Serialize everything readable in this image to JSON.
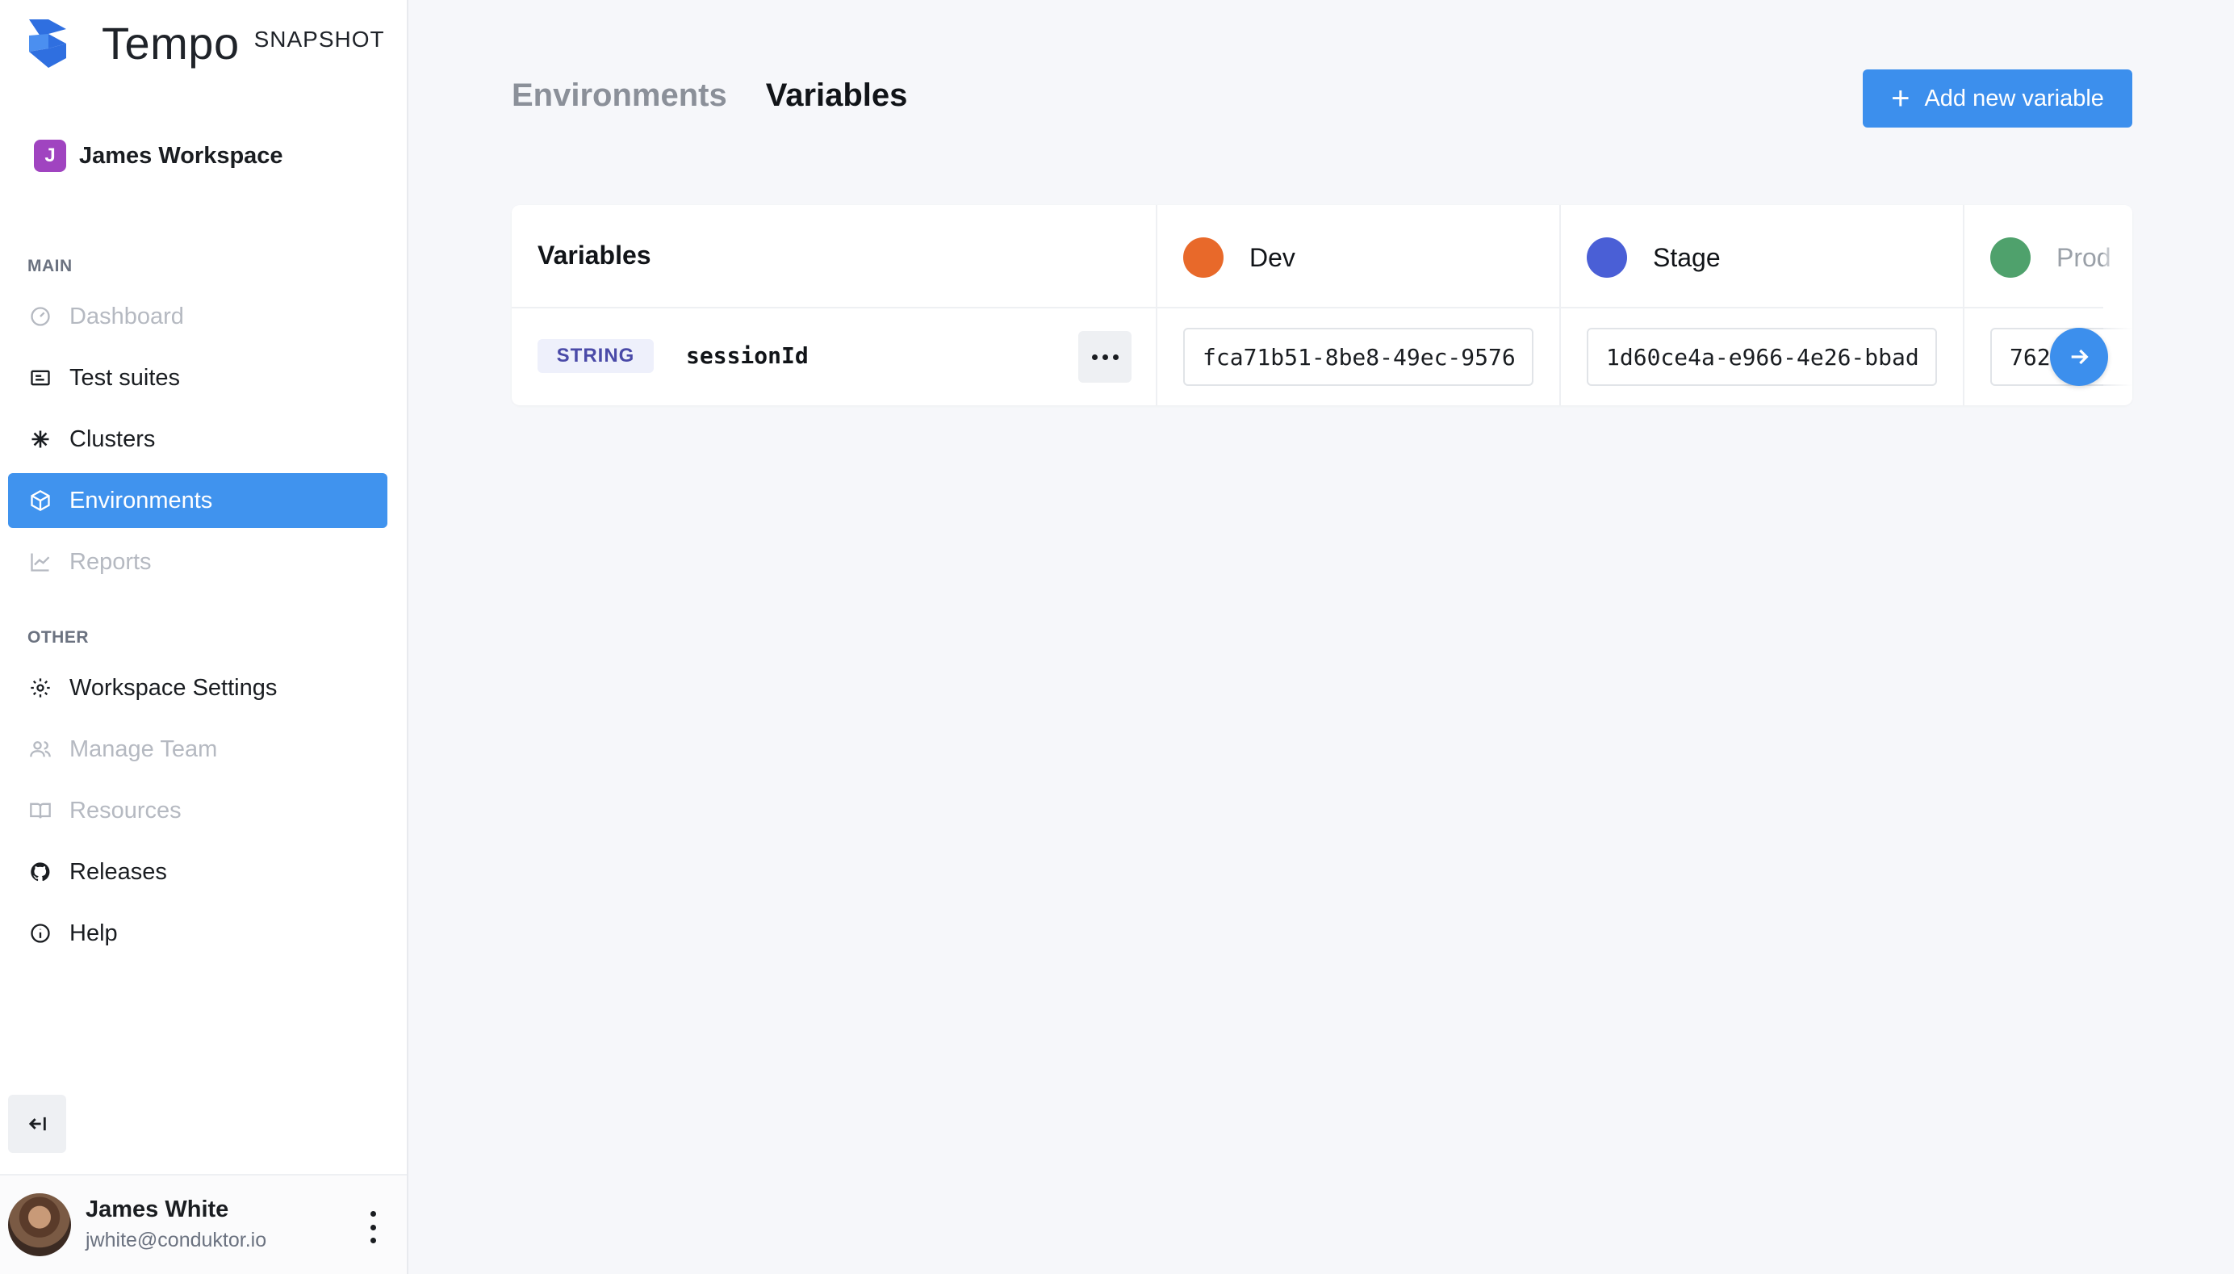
{
  "app": {
    "name": "Tempo",
    "tag": "SNAPSHOT"
  },
  "workspace": {
    "initial": "J",
    "name": "James Workspace",
    "badge_color": "#a044c0"
  },
  "sidebar": {
    "main_label": "MAIN",
    "other_label": "OTHER",
    "main_items": [
      {
        "label": "Dashboard",
        "icon": "gauge-icon",
        "state": "disabled"
      },
      {
        "label": "Test suites",
        "icon": "list-icon",
        "state": "normal"
      },
      {
        "label": "Clusters",
        "icon": "asterisk-icon",
        "state": "normal"
      },
      {
        "label": "Environments",
        "icon": "cube-icon",
        "state": "active"
      },
      {
        "label": "Reports",
        "icon": "chart-icon",
        "state": "disabled"
      }
    ],
    "other_items": [
      {
        "label": "Workspace Settings",
        "icon": "gear-icon",
        "state": "normal"
      },
      {
        "label": "Manage Team",
        "icon": "users-icon",
        "state": "disabled"
      },
      {
        "label": "Resources",
        "icon": "book-icon",
        "state": "disabled"
      },
      {
        "label": "Releases",
        "icon": "github-icon",
        "state": "normal"
      },
      {
        "label": "Help",
        "icon": "info-icon",
        "state": "normal"
      }
    ]
  },
  "user": {
    "name": "James White",
    "email": "jwhite@conduktor.io"
  },
  "header": {
    "tabs": [
      {
        "label": "Environments",
        "active": false
      },
      {
        "label": "Variables",
        "active": true
      }
    ],
    "add_button_label": "Add new variable"
  },
  "table": {
    "first_column_header": "Variables",
    "environments": [
      {
        "name": "Dev",
        "color": "#e8692a"
      },
      {
        "name": "Stage",
        "color": "#4a5fd6"
      },
      {
        "name": "Prod",
        "color": "#4fa16c"
      }
    ],
    "rows": [
      {
        "type": "STRING",
        "name": "sessionId",
        "values": [
          "fca71b51-8be8-49ec-9576",
          "1d60ce4a-e966-4e26-bbad",
          "762"
        ]
      }
    ]
  },
  "colors": {
    "accent": "#3c8fed",
    "active_nav": "#4093ee"
  }
}
